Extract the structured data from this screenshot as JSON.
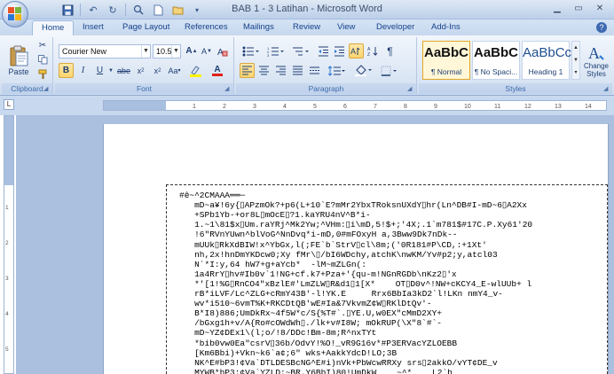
{
  "window": {
    "title": "BAB 1 - 3 Latihan - Microsoft Word",
    "controls": [
      "minimize",
      "maximize",
      "close"
    ]
  },
  "tabs": [
    {
      "label": "Home",
      "active": true
    },
    {
      "label": "Insert"
    },
    {
      "label": "Page Layout"
    },
    {
      "label": "References"
    },
    {
      "label": "Mailings"
    },
    {
      "label": "Review"
    },
    {
      "label": "View"
    },
    {
      "label": "Developer"
    },
    {
      "label": "Add-Ins"
    }
  ],
  "ribbon": {
    "clipboard": {
      "label": "Clipboard",
      "paste_label": "Paste"
    },
    "font": {
      "label": "Font",
      "font_name": "Courier New",
      "font_size": "10.5"
    },
    "paragraph": {
      "label": "Paragraph"
    },
    "styles": {
      "label": "Styles",
      "items": [
        {
          "preview": "AaBbC",
          "name": "¶ Normal"
        },
        {
          "preview": "AaBbC",
          "name": "¶ No Spaci..."
        },
        {
          "preview": "AaBbCc",
          "name": "Heading 1"
        }
      ],
      "change_styles_label": "Change Styles"
    }
  },
  "document": {
    "lines": [
      "#ê~^2CMAAA══─",
      "   mD~a¥!6y{▯APzmOk?+p6(L+10`E?mMr2YbxTRoksnUXdY▯hr(Ln^DB#I-mD~6▯A2Xx",
      "   +SPb1Yb-+or8L▯mOcE▯?1.kaYRU4nV^B*i-",
      "   1.~1\\81$x▯Um.raYRj^Mk2Yw;^VHm:▯i\\mD,5!$+;'4X;.1`m781$#17C.P.Xy61'20",
      "   !6\"RVnYUwn^blVoG^NnDvq*i-mD,0#mFOxyH a,3Bww9Dk7nDk--",
      "   mUUk▯RkXdBIW!x^YbGx,l(;FE`b`StrV▯cl\\8m;('0R181#P\\CD,:+1Xt'",
      "   nh,2x!hnDmYKDcw0;Xy fMr\\▯/bI6WDchy,atchK\\nwKM/Yv#p2;y,atcl03",
      "   N`*I:y,64 hW7+g+aYcb*  -lM~mZLGn(:",
      "   1a4RrY▯hv#Ib0v`1!NG+cf.k7+Pza+'{qu-m!NGnRGDb\\nKz2▯'x",
      "   *'[1!%G▯RnCO4\"xBzlE#'LmZLW▯R&d1▯1[X*    OT▯D0v^!NW+cKCY4_E-wlUUb+ l",
      "   rB*iLVF/Lc^ZLG+cRmY43B'-l!YK.E     Rrx6BbIa3kD2`l!LKn nmY4_v-",
      "   wv*i510~6vmT%K+RKCDtQB'wE#Ia&7VkvmZ¢W▯RKlDtQv'-",
      "   B*I8)886;UmDkRx~4f5W*c/S{%T#`.▯YE.U,w0EX\"cMmD2XY+",
      "   /bGxg1h+v/A{Ro#cOWdWh▯./lk+v#I8W; mOkRUP(\\X\"8`#`-",
      "   mD~YZ¢DEx1\\(l;o/!8/DDc!Bm-8m;R^nxTYt",
      "   *bib0vw0Ea\"csrV▯36b/OdvY!%O!_vR9G16v*#P3ERVacYZLOEBB",
      "   [Km6Bbi)+Vkn~k6`a¢;6\" wks+AakkYdcD!LO;3B",
      "   NK^E#bP3!¢Va`DTLDESBcNG^E#i)nVk+PbWcwRRXy srs▯2akkO/vYT¢DE_v",
      "   MYWB*bP3;¢Va`YZLD;~BR.Y6BbI)80!UmDkW    ~^*    L2`b"
    ]
  },
  "ruler": {
    "ticks": [
      "1",
      "2",
      "3",
      "4",
      "5",
      "6",
      "7",
      "8",
      "9",
      "10",
      "11",
      "12",
      "13",
      "14",
      "15"
    ]
  }
}
